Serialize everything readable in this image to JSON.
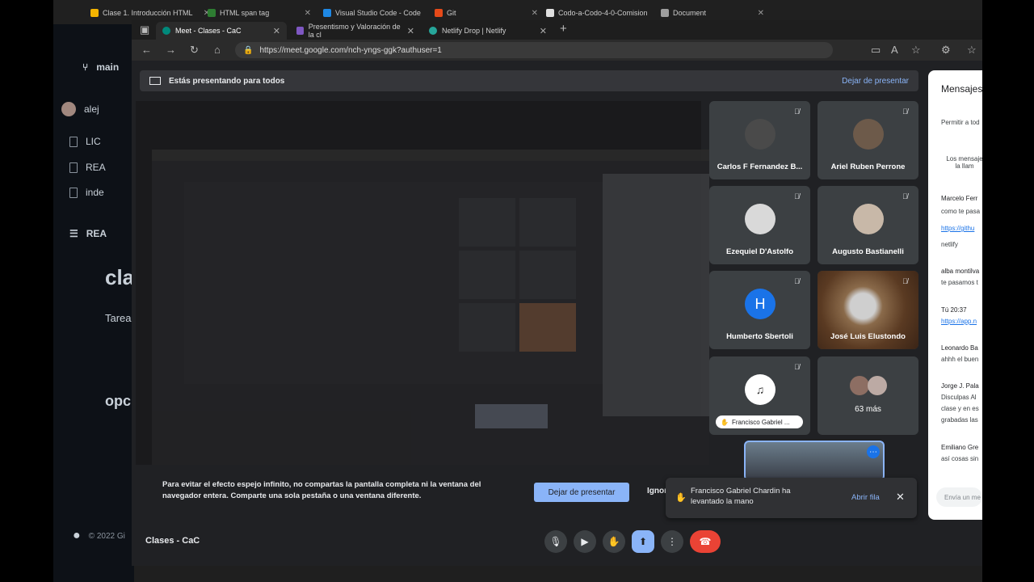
{
  "back_window": {
    "tabs": [
      {
        "label": "Clase 1. Introducción HTML",
        "color": "#f4b400"
      },
      {
        "label": "HTML span tag",
        "color": "#2e7d32"
      },
      {
        "label": "Visual Studio Code - Code",
        "color": "#1e88e5"
      },
      {
        "label": "Git",
        "color": "#e64a19"
      },
      {
        "label": "Codo-a-Codo-4-0-Comision",
        "color": "#e0e0e0"
      },
      {
        "label": "Document",
        "color": "#9e9e9e"
      }
    ],
    "branch": "main",
    "user": "alej",
    "files": [
      "LIC",
      "REA",
      "inde"
    ],
    "readme": "REA",
    "heading": "cla",
    "body_text": "Tarea",
    "section2": "opc",
    "footer": "© 2022 Gi"
  },
  "front_window": {
    "tabs": [
      {
        "label": "Meet - Clases - CaC",
        "color": "#00897b"
      },
      {
        "label": "Presentismo y Valoración de la cl",
        "color": "#7e57c2"
      },
      {
        "label": "Netlify Drop | Netlify",
        "color": "#26a69a"
      }
    ],
    "url": "https://meet.google.com/nch-yngs-ggk?authuser=1"
  },
  "banner": {
    "text": "Estás presentando para todos",
    "stop": "Dejar de presentar"
  },
  "participants": [
    {
      "name": "Carlos F Fernandez B...",
      "initial": "",
      "muted": true
    },
    {
      "name": "Ariel Ruben Perrone",
      "initial": "",
      "muted": true
    },
    {
      "name": "Ezequiel D'Astolfo",
      "initial": "",
      "muted": true
    },
    {
      "name": "Augusto Bastianelli",
      "initial": "",
      "muted": true
    },
    {
      "name": "Humberto Sbertoli",
      "initial": "H",
      "muted": true
    },
    {
      "name": "José Luis Elustondo",
      "initial": "",
      "muted": true
    },
    {
      "name": "Francisco Gabriel ...",
      "initial": "",
      "muted": true,
      "hand_raised": true
    },
    {
      "name": "63 más",
      "initial": "",
      "muted": false
    }
  ],
  "chat": {
    "title": "Mensajes",
    "allow": "Permitir a tod",
    "note": "Los mensaje la llam",
    "messages": [
      {
        "author": "Marcelo Ferr",
        "text": "como te pasa"
      },
      {
        "author": "",
        "text": "https://githu",
        "link": true
      },
      {
        "author": "",
        "text": "netlify"
      },
      {
        "author": "alba montilva",
        "text": "te pasamos t"
      },
      {
        "author": "Tú  20:37",
        "text": "https://app.n",
        "link": true
      },
      {
        "author": "Leonardo Ba",
        "text": "ahhh el buen"
      },
      {
        "author": "Jorge J. Pala",
        "text": "Disculpas Al"
      },
      {
        "author": "",
        "text": "clase y en es"
      },
      {
        "author": "",
        "text": "grabadas las"
      },
      {
        "author": "Emiliano Gre",
        "text": "así cosas sin"
      }
    ],
    "input_placeholder": "Envía un me"
  },
  "warning": "Para evitar el efecto espejo infinito, no compartas la pantalla completa ni la ventana del navegador entera. Comparte una sola pestaña o una ventana diferente.",
  "warning_button": "Dejar de presentar",
  "warning_ignore": "Ignor",
  "toast": {
    "text": "Francisco Gabriel Chardin ha levantado la mano",
    "action": "Abrir fila"
  },
  "meeting_name": "Clases - CaC",
  "colors": {
    "meet_bg": "#202124",
    "accent": "#8ab4f8",
    "end_call": "#ea4335",
    "humberto_avatar": "#1a73e8"
  }
}
